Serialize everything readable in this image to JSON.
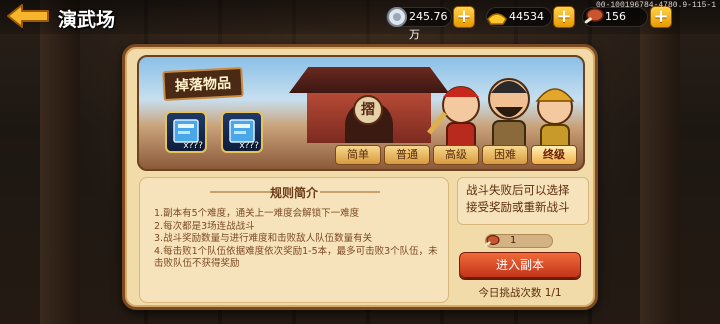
{
  "header": {
    "title": "演武场",
    "device_id": "00-100196784-4780.9-115-1"
  },
  "resources": [
    {
      "name": "silver-coin",
      "value": "245.76万"
    },
    {
      "name": "gold-ingot",
      "value": "44534"
    },
    {
      "name": "meat-stamina",
      "value": "156"
    }
  ],
  "panel": {
    "drop_label": "掉落物品",
    "temple_sign": "摺",
    "drops": [
      {
        "icon": "skill-book-icon",
        "count": "x???"
      },
      {
        "icon": "skill-book-icon",
        "count": "x???"
      }
    ],
    "tabs": [
      {
        "label": "简单",
        "active": false
      },
      {
        "label": "普通",
        "active": false
      },
      {
        "label": "高级",
        "active": false
      },
      {
        "label": "困难",
        "active": false
      },
      {
        "label": "终级",
        "active": true
      }
    ],
    "rules": {
      "title": "规则简介",
      "items": [
        "1.副本有5个难度，通关上一难度会解锁下一难度",
        "2.每次都是3场连战战斗",
        "3.战斗奖励数量与进行难度和击败敌人队伍数量有关",
        "4.每击败1个队伍依据难度依次奖励1-5本，最多可击败3个队伍，未击败队伍不获得奖励"
      ]
    },
    "side_note": "战斗失败后可以选择接受奖励或重新战斗",
    "cost": "1",
    "enter_label": "进入副本",
    "today_count": "今日挑战次数 1/1"
  },
  "colors": {
    "panel": "#f1dba8",
    "border": "#7a4b21",
    "accent": "#e89a00",
    "button": "#d94a24"
  }
}
